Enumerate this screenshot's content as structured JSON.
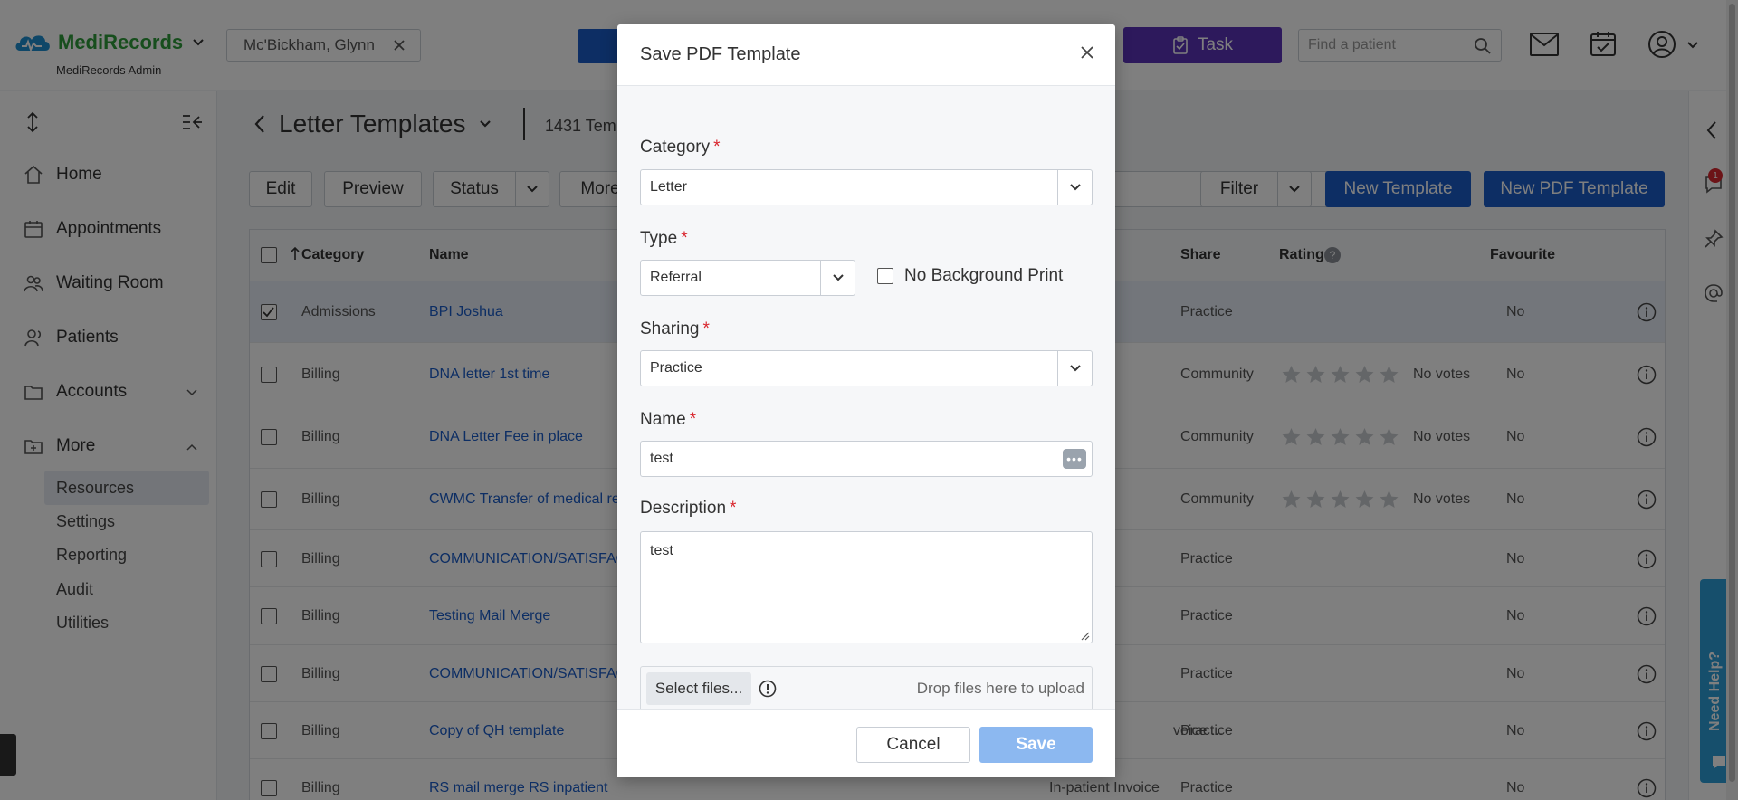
{
  "header": {
    "logo_text": "MediRecords",
    "logo_sub": "MediRecords Admin",
    "patient_chip": "Mc'Bickham, Glynn",
    "task_label": "Task",
    "find_patient_placeholder": "Find a patient"
  },
  "sidebar": {
    "items": [
      {
        "label": "Home",
        "icon": "home-icon"
      },
      {
        "label": "Appointments",
        "icon": "calendar-icon"
      },
      {
        "label": "Waiting Room",
        "icon": "people-icon"
      },
      {
        "label": "Patients",
        "icon": "patients-icon"
      },
      {
        "label": "Accounts",
        "icon": "folder-icon"
      },
      {
        "label": "More",
        "icon": "folder-plus-icon"
      }
    ],
    "sub_items": [
      "Resources",
      "Settings",
      "Reporting",
      "Audit",
      "Utilities"
    ]
  },
  "content": {
    "title": "Letter Templates",
    "count_text": "1431 Tem",
    "toolbar": {
      "edit": "Edit",
      "preview": "Preview",
      "status": "Status",
      "more": "More",
      "filter": "Filter",
      "new_template": "New Template",
      "new_pdf_template": "New PDF Template"
    },
    "columns": {
      "category": "Category",
      "name": "Name",
      "share": "Share",
      "rating": "Rating",
      "favourite": "Favourite"
    },
    "rows": [
      {
        "category": "Admissions",
        "name": "BPI Joshua",
        "type": "",
        "share": "Practice",
        "rating": "",
        "favourite": "No"
      },
      {
        "category": "Billing",
        "name": "DNA letter 1st time",
        "type": "",
        "share": "Community",
        "rating": "No votes",
        "favourite": "No"
      },
      {
        "category": "Billing",
        "name": "DNA Letter Fee in place",
        "type": "",
        "share": "Community",
        "rating": "No votes",
        "favourite": "No"
      },
      {
        "category": "Billing",
        "name": "CWMC Transfer of medical re",
        "type": "",
        "share": "Community",
        "rating": "No votes",
        "favourite": "No"
      },
      {
        "category": "Billing",
        "name": "COMMUNICATION/SATISFAC",
        "type": "",
        "share": "Practice",
        "rating": "",
        "favourite": "No"
      },
      {
        "category": "Billing",
        "name": "Testing Mail Merge",
        "type": "",
        "share": "Practice",
        "rating": "",
        "favourite": "No"
      },
      {
        "category": "Billing",
        "name": "COMMUNICATION/SATISFAC",
        "type": "",
        "share": "Practice",
        "rating": "",
        "favourite": "No"
      },
      {
        "category": "Billing",
        "name": "Copy of QH template",
        "type": "voice ...",
        "share": "Practice",
        "rating": "",
        "favourite": "No"
      },
      {
        "category": "Billing",
        "name": "RS mail merge RS inpatient",
        "type": "In-patient Invoice",
        "share": "Practice",
        "rating": "",
        "favourite": "No"
      }
    ]
  },
  "right_rail": {
    "badge_count": "1",
    "need_help": "Need Help?"
  },
  "modal": {
    "title": "Save PDF Template",
    "category_label": "Category",
    "category_value": "Letter",
    "type_label": "Type",
    "type_value": "Referral",
    "no_background_print": "No Background Print",
    "sharing_label": "Sharing",
    "sharing_value": "Practice",
    "name_label": "Name",
    "name_value": "test",
    "description_label": "Description",
    "description_value": "test",
    "select_files": "Select files...",
    "drop_hint": "Drop files here to upload",
    "required_mark": "*",
    "cancel": "Cancel",
    "save": "Save"
  },
  "colors": {
    "primary": "#1a5cc8",
    "task": "#5a32b8",
    "brand_green": "#2e9c3a",
    "required": "#d9262e",
    "save_disabled": "#8cb8f0"
  }
}
